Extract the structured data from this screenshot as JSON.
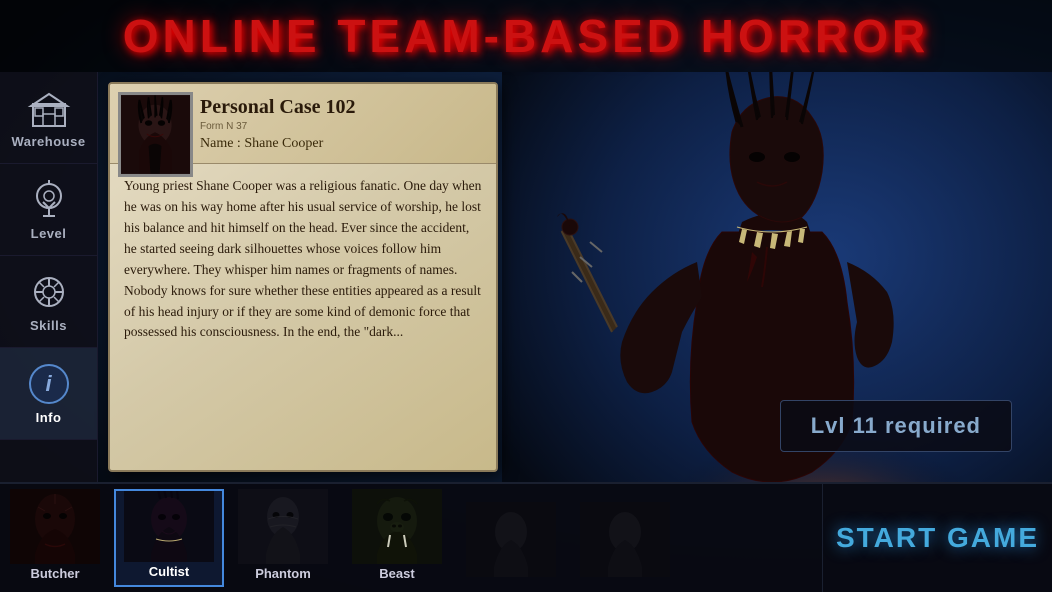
{
  "title": "ONLINE TEAM-BASED HORROR",
  "sidebar": {
    "items": [
      {
        "id": "warehouse",
        "label": "Warehouse",
        "icon": "warehouse-icon"
      },
      {
        "id": "level",
        "label": "Level",
        "icon": "level-icon"
      },
      {
        "id": "skills",
        "label": "Skills",
        "icon": "skills-icon"
      },
      {
        "id": "info",
        "label": "Info",
        "icon": "info-icon",
        "active": true
      }
    ]
  },
  "caseFile": {
    "title": "Personal Case 102",
    "formNum": "Form N 37",
    "nameLabel": "Name : Shane Cooper",
    "description": "Young priest Shane Cooper was a religious fanatic. One day when he was on his way home after his usual service of worship, he lost his balance and hit himself on the head. Ever since the accident, he started seeing dark silhouettes whose voices follow him everywhere. They whisper him names or fragments of names. Nobody knows for sure whether these entities appeared as a result of his head injury or if they are some kind of demonic force that possessed his consciousness. In the end, the \"dark..."
  },
  "levelBadge": "Lvl 11 required",
  "characters": [
    {
      "id": "butcher",
      "label": "Butcher",
      "selected": false
    },
    {
      "id": "cultist",
      "label": "Cultist",
      "selected": true
    },
    {
      "id": "phantom",
      "label": "Phantom",
      "selected": false
    },
    {
      "id": "beast",
      "label": "Beast",
      "selected": false
    },
    {
      "id": "char5",
      "label": "",
      "selected": false
    },
    {
      "id": "char6",
      "label": "",
      "selected": false
    }
  ],
  "startButton": "START GAME",
  "colors": {
    "title": "#cc1111",
    "levelBadge": "#88aacc",
    "startBtn": "#44aadd"
  }
}
